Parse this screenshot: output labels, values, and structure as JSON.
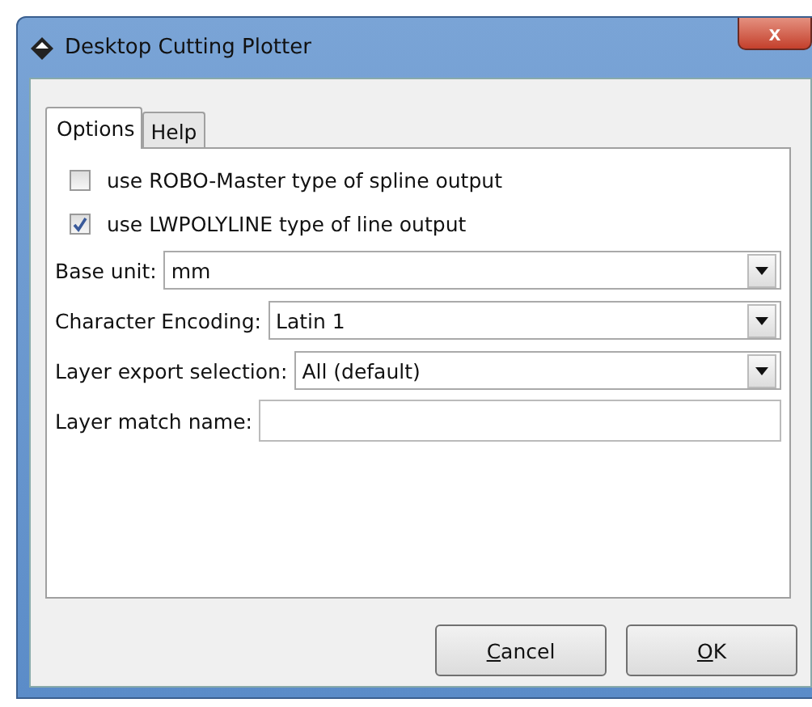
{
  "window": {
    "title": "Desktop Cutting Plotter",
    "close": "x"
  },
  "tabs": [
    {
      "label": "Options",
      "selected": true
    },
    {
      "label": "Help",
      "selected": false
    }
  ],
  "options": [
    {
      "kind": "checkbox",
      "label": "use ROBO-Master type of spline output",
      "checked": false
    },
    {
      "kind": "checkbox",
      "label": "use LWPOLYLINE type of line output",
      "checked": true
    },
    {
      "kind": "dropdown",
      "label": "Base unit:",
      "value": "mm"
    },
    {
      "kind": "dropdown",
      "label": "Character Encoding:",
      "value": "Latin 1"
    },
    {
      "kind": "dropdown",
      "label": "Layer export selection:",
      "value": "All (default)"
    },
    {
      "kind": "text",
      "label": "Layer match name:"
    }
  ],
  "buttons": [
    {
      "label": "Cancel",
      "mnemonic_underlined": true
    },
    {
      "label": "OK",
      "mnemonic_underlined": true
    }
  ]
}
